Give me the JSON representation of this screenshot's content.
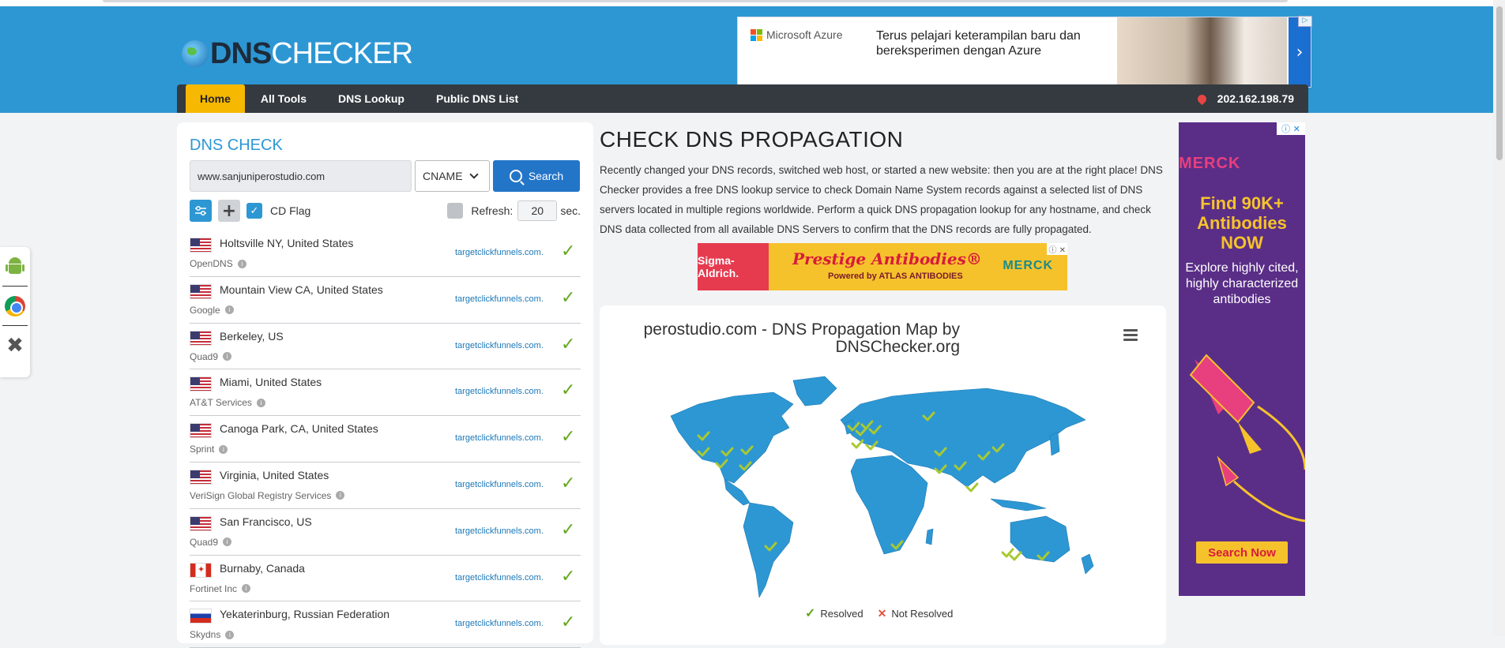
{
  "brand": {
    "dns": "DNS",
    "checker": "CHECKER"
  },
  "top_ad": {
    "brand": "Microsoft Azure",
    "text": "Terus pelajari keterampilan baru dan bereksperimen dengan Azure",
    "arrow": "›"
  },
  "nav": {
    "items": [
      "Home",
      "All Tools",
      "DNS Lookup",
      "Public DNS List"
    ],
    "ip": "202.162.198.79"
  },
  "dns_check": {
    "title": "DNS CHECK",
    "domain": "www.sanjuniperostudio.com",
    "record_type": "CNAME",
    "search_label": "Search",
    "cd_flag_label": "CD Flag",
    "refresh_label": "Refresh:",
    "refresh_value": "20",
    "sec_label": "sec.",
    "results": [
      {
        "flag": "us",
        "location": "Holtsville NY, United States",
        "provider": "OpenDNS",
        "result": "targetclickfunnels.com."
      },
      {
        "flag": "us",
        "location": "Mountain View CA, United States",
        "provider": "Google",
        "result": "targetclickfunnels.com."
      },
      {
        "flag": "us",
        "location": "Berkeley, US",
        "provider": "Quad9",
        "result": "targetclickfunnels.com."
      },
      {
        "flag": "us",
        "location": "Miami, United States",
        "provider": "AT&T Services",
        "result": "targetclickfunnels.com."
      },
      {
        "flag": "us",
        "location": "Canoga Park, CA, United States",
        "provider": "Sprint",
        "result": "targetclickfunnels.com."
      },
      {
        "flag": "us",
        "location": "Virginia, United States",
        "provider": "VeriSign Global Registry Services",
        "result": "targetclickfunnels.com."
      },
      {
        "flag": "us",
        "location": "San Francisco, US",
        "provider": "Quad9",
        "result": "targetclickfunnels.com."
      },
      {
        "flag": "ca",
        "location": "Burnaby, Canada",
        "provider": "Fortinet Inc",
        "result": "targetclickfunnels.com."
      },
      {
        "flag": "ru",
        "location": "Yekaterinburg, Russian Federation",
        "provider": "Skydns",
        "result": "targetclickfunnels.com."
      }
    ]
  },
  "main": {
    "title": "CHECK DNS PROPAGATION",
    "description": "Recently changed your DNS records, switched web host, or started a new website: then you are at the right place! DNS Checker provides a free DNS lookup service to check Domain Name System records against a selected list of DNS servers located in multiple regions worldwide. Perform a quick DNS propagation lookup for any hostname, and check DNS data collected from all available DNS Servers to confirm that the DNS records are fully propagated."
  },
  "mid_ad": {
    "brand": "Sigma-Aldrich.",
    "headline": "Prestige Antibodies®",
    "powered": "Powered by ATLAS ANTIBODIES",
    "logo": "MERCK"
  },
  "map": {
    "title_line1": "perostudio.com - DNS Propagation Map by",
    "title_line2": "DNSChecker.org",
    "legend_resolved": "Resolved",
    "legend_not_resolved": "Not Resolved"
  },
  "right_ad": {
    "logo": "MERCK",
    "headline": "Find 90K+ Antibodies NOW",
    "sub": "Explore highly cited, highly characterized antibodies",
    "button": "Search Now"
  },
  "colors": {
    "header": "#2d97d3",
    "nav": "#343a40",
    "active_tab": "#f6b800",
    "resolved": "#64a81c",
    "not_resolved": "#e2543e"
  }
}
